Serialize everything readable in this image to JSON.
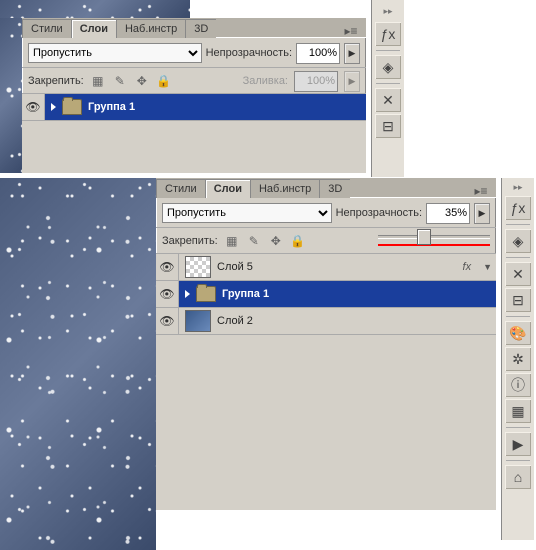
{
  "tabs": {
    "styles": "Стили",
    "layers": "Слои",
    "toolpresets": "Наб.инстр",
    "threeD": "3D"
  },
  "labels": {
    "opacity": "Непрозрачность:",
    "lock": "Закрепить:",
    "fill": "Заливка:",
    "fx": "fx"
  },
  "panel1": {
    "blend_mode": "Пропустить",
    "opacity_value": "100%",
    "fill_value": "100%",
    "layers": [
      {
        "name": "Группа 1",
        "kind": "group",
        "selected": true
      }
    ]
  },
  "panel2": {
    "blend_mode": "Пропустить",
    "opacity_value": "35%",
    "slider_pos_pct": 35,
    "layers": [
      {
        "name": "Слой 5",
        "kind": "layer-checker",
        "selected": false,
        "fx": true
      },
      {
        "name": "Группа 1",
        "kind": "group",
        "selected": true
      },
      {
        "name": "Слой 2",
        "kind": "layer-img",
        "selected": false
      }
    ]
  },
  "dock": {
    "group1": [
      "fx-icon",
      "layers-icon",
      "tools-icon",
      "align-icon"
    ],
    "group2": [
      "fx-icon",
      "layers-icon",
      "tools-icon",
      "align-icon",
      "palette-icon",
      "settings-icon",
      "info-icon",
      "swatches-icon",
      "actions-icon",
      "camera-icon"
    ]
  }
}
